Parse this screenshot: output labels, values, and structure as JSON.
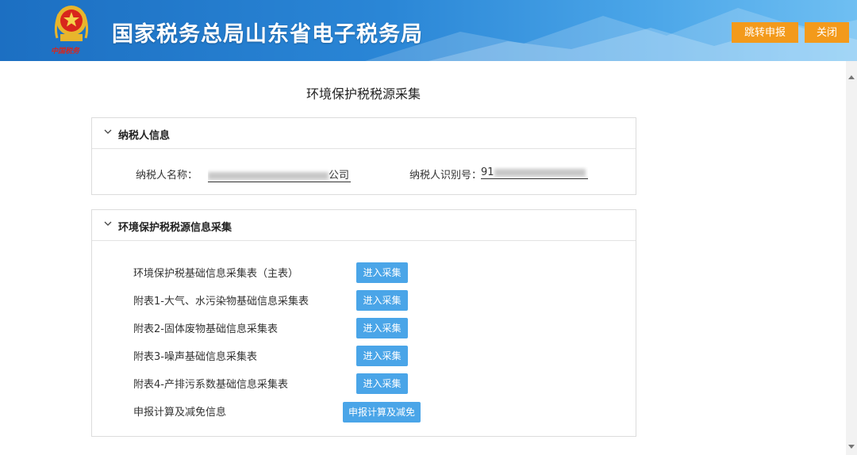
{
  "header": {
    "site_title": "国家税务总局山东省电子税务局",
    "emblem_text": "中国税务",
    "declare_button": "跳转申报",
    "close_button": "关闭"
  },
  "page": {
    "title": "环境保护税税源采集"
  },
  "taxpayer_panel": {
    "title": "纳税人信息",
    "name_label": "纳税人名称：",
    "name_value_suffix": "公司",
    "id_label": "纳税人识别号：",
    "id_value_prefix": "91"
  },
  "collection_panel": {
    "title": "环境保护税税源信息采集",
    "rows": [
      {
        "label": "环境保护税基础信息采集表（主表）",
        "button": "进入采集"
      },
      {
        "label": "附表1-大气、水污染物基础信息采集表",
        "button": "进入采集"
      },
      {
        "label": "附表2-固体废物基础信息采集表",
        "button": "进入采集"
      },
      {
        "label": "附表3-噪声基础信息采集表",
        "button": "进入采集"
      },
      {
        "label": "附表4-产排污系数基础信息采集表",
        "button": "进入采集"
      },
      {
        "label": "申报计算及减免信息",
        "button": "申报计算及减免"
      }
    ]
  },
  "colors": {
    "header_blue": "#2a86d6",
    "orange_button": "#f39a1b",
    "blue_button": "#4aa5e8"
  }
}
